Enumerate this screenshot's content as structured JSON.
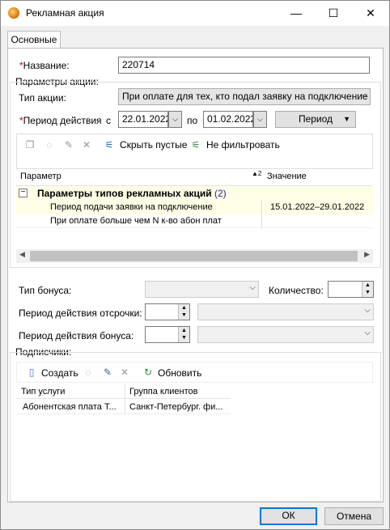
{
  "window": {
    "title": "Рекламная акция",
    "minimize": "—",
    "maximize": "☐",
    "close": "✕"
  },
  "tab": {
    "label": "Основные"
  },
  "form": {
    "name_label": "Название:",
    "name_value": "220714",
    "params_group": "Параметры акции:",
    "type_label": "Тип акции:",
    "type_value": "При оплате для тех, кто подал заявку на подключение",
    "period_label": "Период действия",
    "from_label": "с",
    "from_value": "22.01.2022",
    "to_label": "по",
    "to_value": "01.02.2022",
    "period_button": "Период"
  },
  "toolbar": {
    "hide_empty": "Скрыть пустые",
    "no_filter": "Не фильтровать"
  },
  "grid": {
    "col_param": "Параметр",
    "col_value": "Значение",
    "sort_indicator": "▲2",
    "group_title": "Параметры типов рекламных акций",
    "group_count": "(2)",
    "rows": [
      {
        "param": "Период подачи заявки на подключение",
        "value": "15.01.2022–29.01.2022"
      },
      {
        "param": "При оплате больше чем N к-во абон плат",
        "value": ""
      }
    ]
  },
  "bonus": {
    "type_label": "Тип бонуса:",
    "qty_label": "Количество:",
    "defer_label": "Период действия отсрочки:",
    "bonus_period_label": "Период действия бонуса:"
  },
  "subscribers": {
    "label": "Подписчики:",
    "create": "Создать",
    "refresh": "Обновить",
    "col_service": "Тип услуги",
    "col_group": "Группа клиентов",
    "row": {
      "service": "Абонентская плата Т...",
      "group": "Санкт-Петербург. фи..."
    }
  },
  "footer": {
    "ok": "ОК",
    "cancel": "Отмена"
  }
}
